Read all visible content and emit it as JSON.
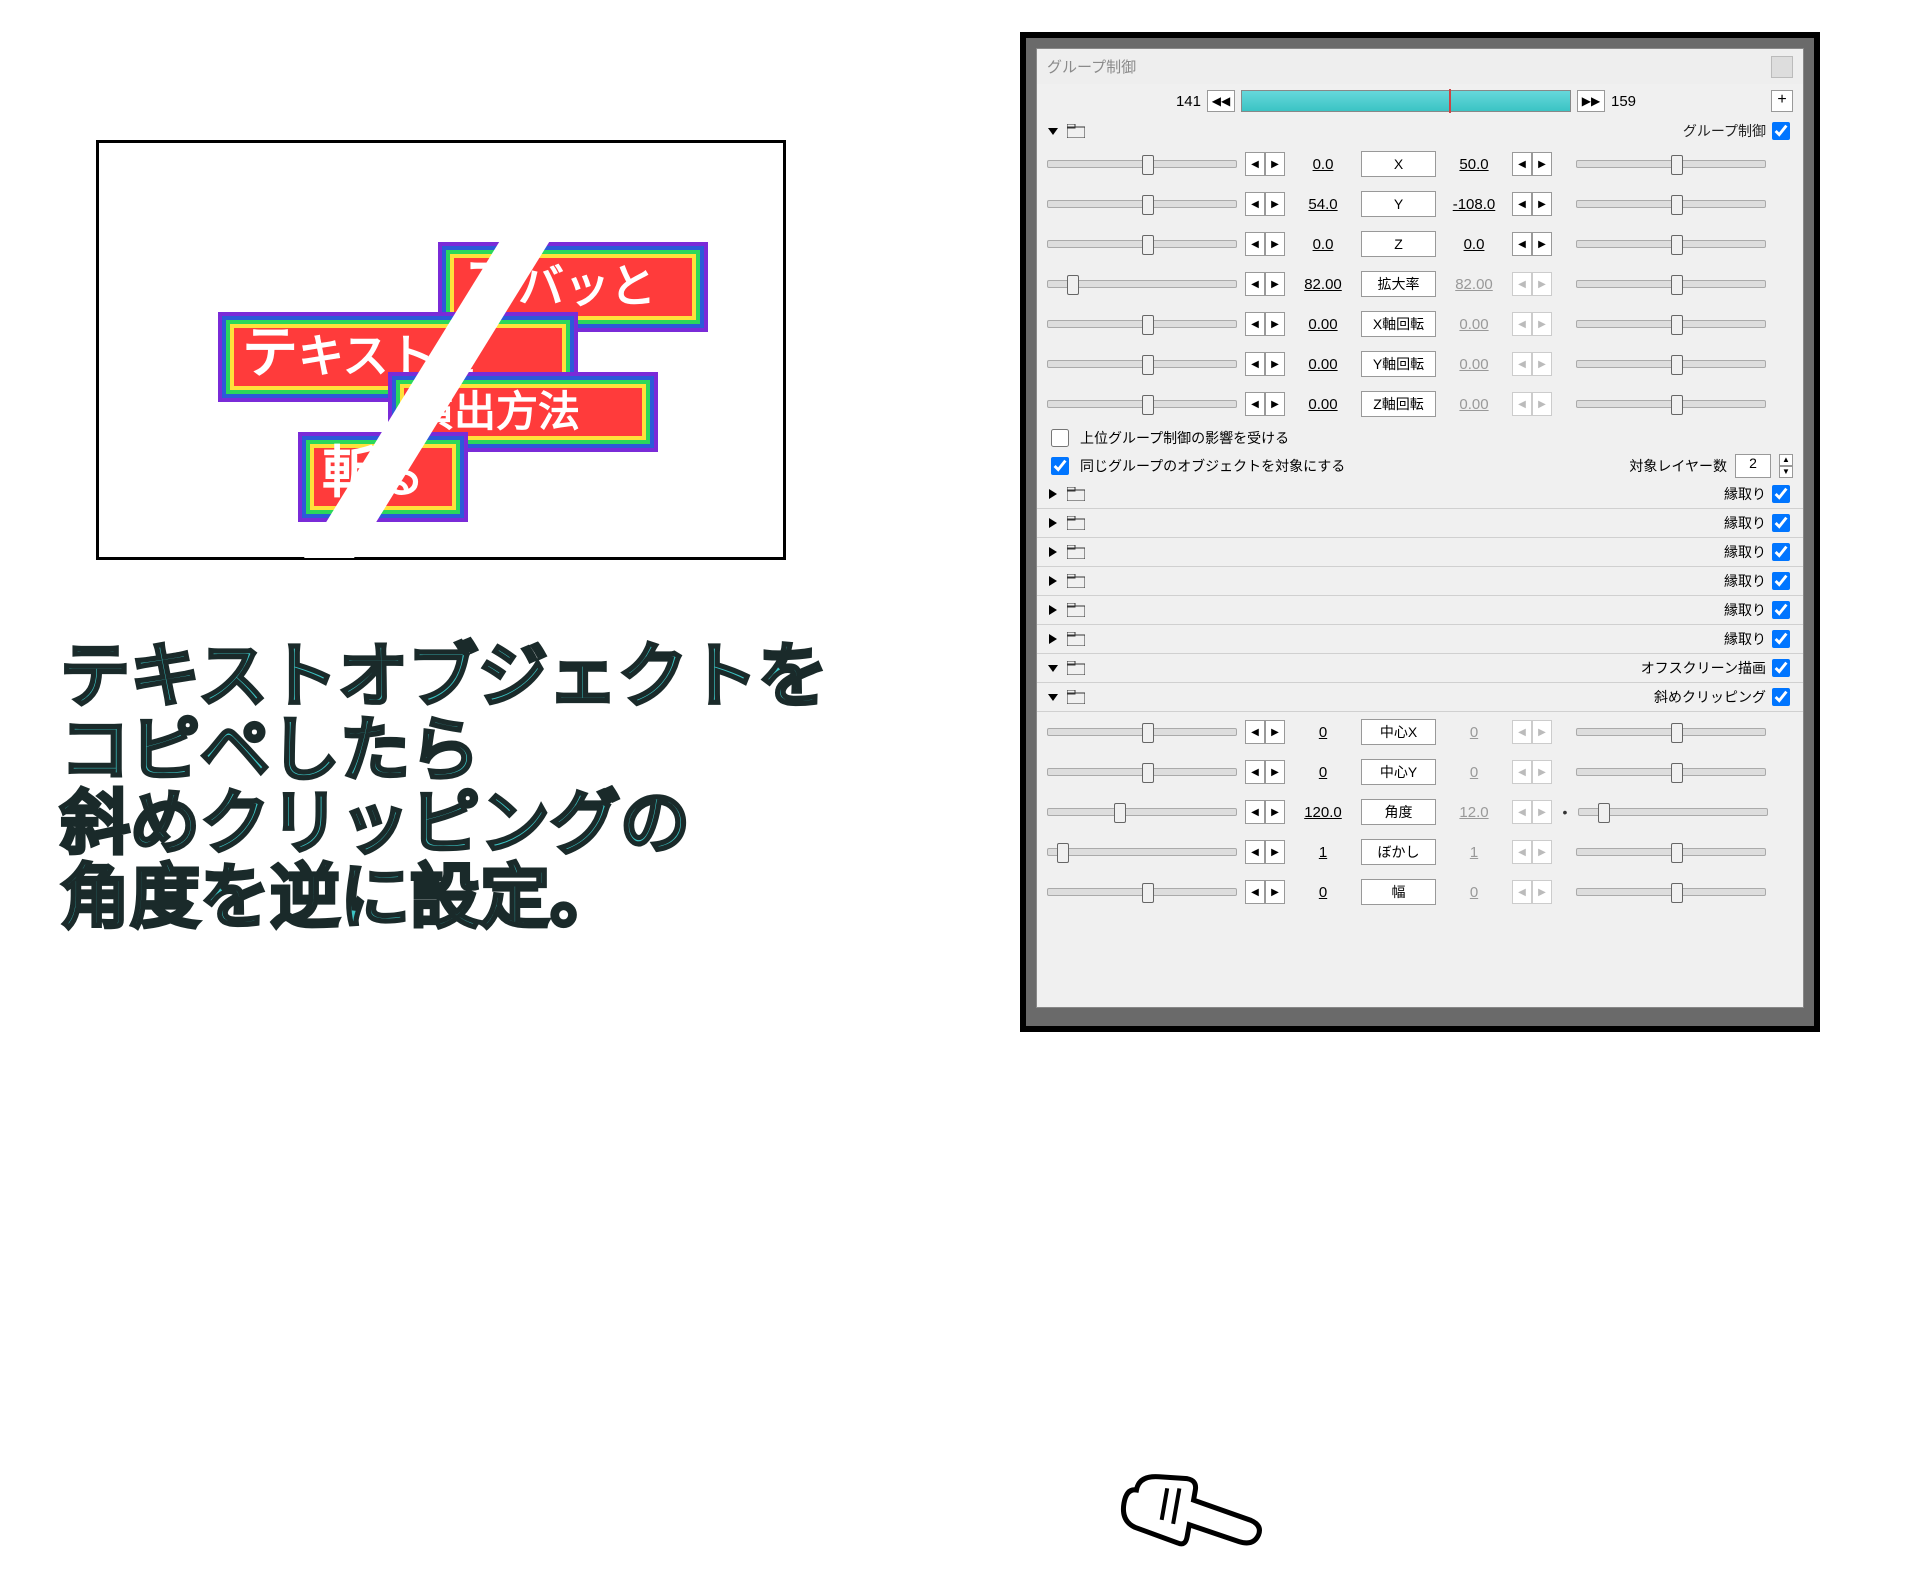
{
  "panel_title": "グループ制御",
  "timeline": {
    "start": "141",
    "end": "159"
  },
  "group_control_label": "グループ制御",
  "params": [
    {
      "name": "X",
      "v1": "0.0",
      "v2": "50.0",
      "p1": 50,
      "p2": 50,
      "dim2": false
    },
    {
      "name": "Y",
      "v1": "54.0",
      "v2": "-108.0",
      "p1": 50,
      "p2": 50,
      "dim2": false
    },
    {
      "name": "Z",
      "v1": "0.0",
      "v2": "0.0",
      "p1": 50,
      "p2": 50,
      "dim2": false
    },
    {
      "name": "拡大率",
      "v1": "82.00",
      "v2": "82.00",
      "p1": 10,
      "p2": 50,
      "dim2": true
    },
    {
      "name": "X軸回転",
      "v1": "0.00",
      "v2": "0.00",
      "p1": 50,
      "p2": 50,
      "dim2": true
    },
    {
      "name": "Y軸回転",
      "v1": "0.00",
      "v2": "0.00",
      "p1": 50,
      "p2": 50,
      "dim2": true
    },
    {
      "name": "Z軸回転",
      "v1": "0.00",
      "v2": "0.00",
      "p1": 50,
      "p2": 50,
      "dim2": true
    }
  ],
  "options": {
    "upper": {
      "label": "上位グループ制御の影響を受ける",
      "checked": false
    },
    "same": {
      "label": "同じグループのオブジェクトを対象にする",
      "checked": true
    },
    "layer_label": "対象レイヤー数",
    "layer_value": "2"
  },
  "border_label": "縁取り",
  "border_count": 6,
  "offscreen_label": "オフスクリーン描画",
  "clip_label": "斜めクリッピング",
  "clip_params": [
    {
      "name": "中心X",
      "v1": "0",
      "v2": "0",
      "p1": 50,
      "p2": 50,
      "dim2": true,
      "star": false
    },
    {
      "name": "中心Y",
      "v1": "0",
      "v2": "0",
      "p1": 50,
      "p2": 50,
      "dim2": true,
      "star": false
    },
    {
      "name": "角度",
      "v1": "120.0",
      "v2": "12.0",
      "p1": 35,
      "p2": 10,
      "dim2": true,
      "star": true
    },
    {
      "name": "ぼかし",
      "v1": "1",
      "v2": "1",
      "p1": 5,
      "p2": 50,
      "dim2": true,
      "star": false
    },
    {
      "name": "幅",
      "v1": "0",
      "v2": "0",
      "p1": 50,
      "p2": 50,
      "dim2": true,
      "star": false
    }
  ],
  "instruction_lines": [
    "テキストオブジェクトを",
    "コピペしたら",
    "斜めクリッピングの",
    "角度を逆に設定。"
  ],
  "preview_text": {
    "l1a": "ズ",
    "l1b": "バッと",
    "l2a": "テ",
    "l2b": "キストを",
    "l3": "演出方法",
    "l4a": "斬",
    "l4b": "る"
  }
}
